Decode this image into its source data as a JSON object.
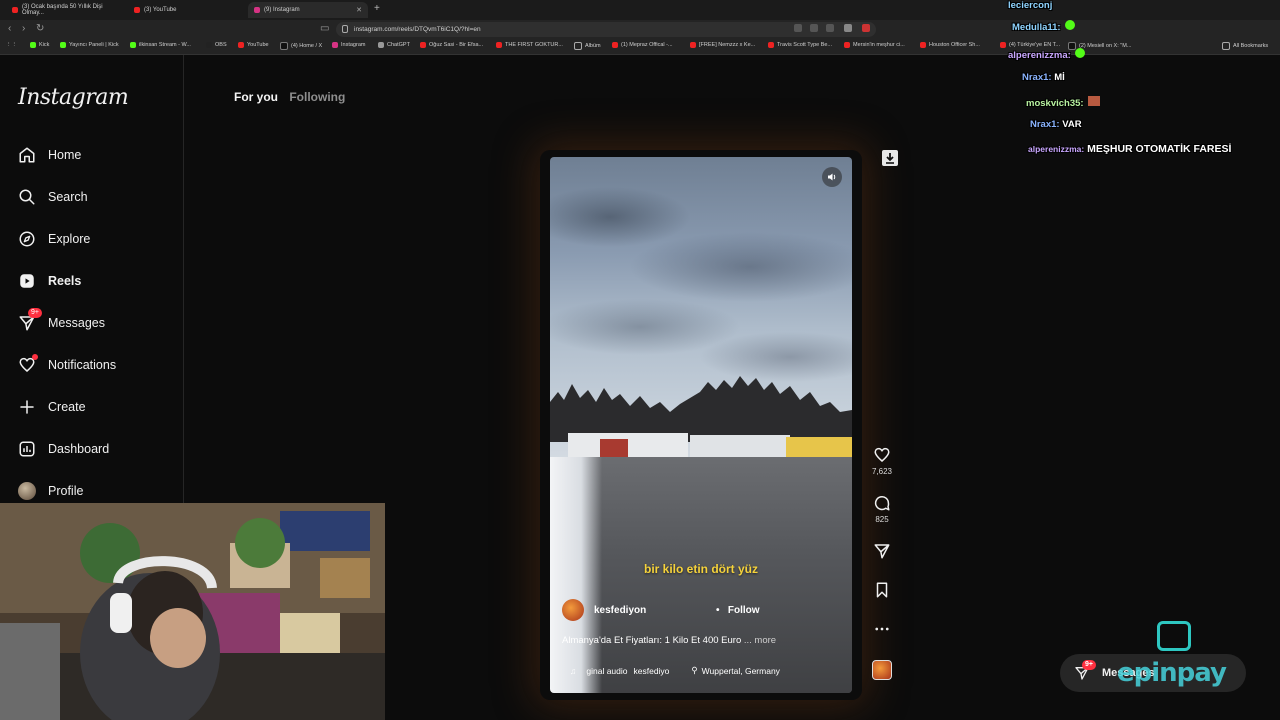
{
  "browser": {
    "tabs": [
      {
        "label": "(3) Ocak başında 50 Yıllık Dişi Olmay..."
      },
      {
        "label": "(3) YouTube"
      },
      {
        "label": "(9) Instagram"
      }
    ],
    "url": "instagram.com/reels/DTQvmT6iC1Q/?hl=en",
    "bookmarks": [
      "Kick",
      "Yayıncı Paneli | Kick",
      "ilkinsan Stream - W...",
      "OBS",
      "YouTube",
      "(4) Home / X",
      "Instagram",
      "ChatGPT",
      "Oğuz Sasi - Bir Efsa...",
      "THE FIRST GOKTUR...",
      "Albüm",
      "(1) Mepraz Offical -...",
      "[FREE] Nemzzz x Ke...",
      "Travis Scott Type Be...",
      "Mersin'in meşhur ci...",
      "Houston Officer Sh...",
      "(4) Türkiye'ye EN T...",
      "(2) Mesiell on X: \"M...",
      "All Bookmarks"
    ]
  },
  "sidebar": {
    "logo": "Instagram",
    "items": [
      {
        "label": "Home",
        "icon": "home-icon"
      },
      {
        "label": "Search",
        "icon": "search-icon"
      },
      {
        "label": "Explore",
        "icon": "compass-icon"
      },
      {
        "label": "Reels",
        "icon": "reels-icon"
      },
      {
        "label": "Messages",
        "icon": "messenger-icon",
        "badge": "9+"
      },
      {
        "label": "Notifications",
        "icon": "heart-icon"
      },
      {
        "label": "Create",
        "icon": "plus-icon"
      },
      {
        "label": "Dashboard",
        "icon": "dashboard-icon"
      },
      {
        "label": "Profile",
        "icon": "avatar"
      }
    ]
  },
  "feed_tabs": {
    "for_you": "For you",
    "following": "Following"
  },
  "reel": {
    "subtitle": "bir kilo etin dört yüz",
    "author": "kesfediyon",
    "follow_dot": "•",
    "follow": "Follow",
    "caption": "Almanya'da Et Fiyatları: 1 Kilo Et 400 Euro",
    "more": "... more",
    "audio": "ginal audio",
    "audio_author": "kesfediyo",
    "location": "Wuppertal, Germany",
    "likes": "7,623",
    "comments": "825"
  },
  "chat": [
    {
      "user": "lecierconj",
      "text": ""
    },
    {
      "user": "Medulla11:",
      "text": ""
    },
    {
      "user": "alperenizzma:",
      "text": ""
    },
    {
      "user": "Nrax1:",
      "text": "Mİ"
    },
    {
      "user": "moskvich35:",
      "text": ""
    },
    {
      "user": "Nrax1:",
      "text": "VAR"
    },
    {
      "user": "alperenizzma:",
      "text": "MEŞHUR OTOMATİK FARESİ"
    }
  ],
  "messages_pill": {
    "label": "Messages",
    "badge": "9+"
  },
  "sponsor": {
    "name": "epinpay"
  },
  "colors": {
    "badge": "#ff3040",
    "subtitle": "#f5d23b",
    "sponsor": "#2ec7c1"
  }
}
